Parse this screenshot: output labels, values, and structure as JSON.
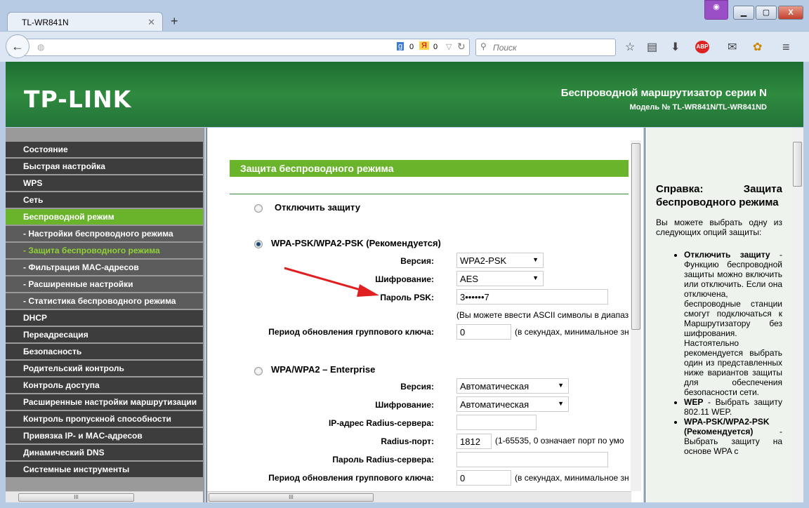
{
  "browser": {
    "tab_title": "TL-WR841N",
    "search_placeholder": "Поиск",
    "counter1": "0",
    "counter2": "0"
  },
  "header": {
    "logo": "TP-LINK",
    "title": "Беспроводной маршрутизатор серии N",
    "model": "Модель № TL-WR841N/TL-WR841ND"
  },
  "sidebar": {
    "items": [
      {
        "label": "Состояние",
        "type": "top"
      },
      {
        "label": "Быстрая настройка",
        "type": "top"
      },
      {
        "label": "WPS",
        "type": "top"
      },
      {
        "label": "Сеть",
        "type": "top"
      },
      {
        "label": "Беспроводной режим",
        "type": "active"
      },
      {
        "label": "- Настройки беспроводного режима",
        "type": "sub"
      },
      {
        "label": "- Защита беспроводного режима",
        "type": "current"
      },
      {
        "label": "- Фильтрация MAC-адресов",
        "type": "sub"
      },
      {
        "label": "- Расширенные настройки",
        "type": "sub"
      },
      {
        "label": "- Статистика беспроводного режима",
        "type": "sub"
      },
      {
        "label": "DHCP",
        "type": "top"
      },
      {
        "label": "Переадресация",
        "type": "top"
      },
      {
        "label": "Безопасность",
        "type": "top"
      },
      {
        "label": "Родительский контроль",
        "type": "top"
      },
      {
        "label": "Контроль доступа",
        "type": "top"
      },
      {
        "label": "Расширенные настройки маршрутизации",
        "type": "top"
      },
      {
        "label": "Контроль пропускной способности",
        "type": "top"
      },
      {
        "label": "Привязка IP- и MAC-адресов",
        "type": "top"
      },
      {
        "label": "Динамический DNS",
        "type": "top"
      },
      {
        "label": "Системные инструменты",
        "type": "top"
      }
    ]
  },
  "main": {
    "title": "Защита беспроводного режима",
    "disable": {
      "label": "Отключить защиту",
      "selected": false
    },
    "psk": {
      "label": "WPA-PSK/WPA2-PSK (Рекомендуется)",
      "selected": true,
      "version_label": "Версия:",
      "version": "WPA2-PSK",
      "enc_label": "Шифрование:",
      "enc": "AES",
      "pass_label": "Пароль PSK:",
      "pass": "3••••••7",
      "pass_note": "(Вы можете ввести ASCII символы в диапаз",
      "period_label": "Период обновления группового ключа:",
      "period": "0",
      "period_note": "(в секундах, минимальное зн"
    },
    "ent": {
      "label": "WPA/WPA2 – Enterprise",
      "selected": false,
      "version_label": "Версия:",
      "version": "Автоматическая",
      "enc_label": "Шифрование:",
      "enc": "Автоматическая",
      "ip_label": "IP-адрес Radius-сервера:",
      "ip": "",
      "port_label": "Radius-порт:",
      "port": "1812",
      "port_note": "(1-65535, 0 означает порт по умо",
      "pass_label": "Пароль Radius-сервера:",
      "pass": "",
      "period_label": "Период обновления группового ключа:",
      "period": "0",
      "period_note": "(в секундах, минимальное зн"
    }
  },
  "help": {
    "title": "Справка: Защита беспроводного режима",
    "intro": "Вы можете выбрать одну из следующих опций защиты:",
    "items": [
      {
        "term": "Отключить защиту",
        "text": " - Функцию беспроводной защиты можно включить или отключить. Если она отключена, беспроводные станции смогут подключаться к Маршрутизатору без шифрования. Настоятельно рекомендуется выбрать один из представленных ниже вариантов защиты для обеспечения безопасности сети."
      },
      {
        "term": "WEP",
        "text": " - Выбрать защиту 802.11 WEP."
      },
      {
        "term": "WPA-PSK/WPA2-PSK (Рекомендуется)",
        "text": " - Выбрать защиту на основе WPA с"
      }
    ]
  },
  "colors": {
    "accent": "#6ab42c",
    "header": "#2f8a3e",
    "menu": "#3d3d3d",
    "arrow": "#e02020"
  }
}
